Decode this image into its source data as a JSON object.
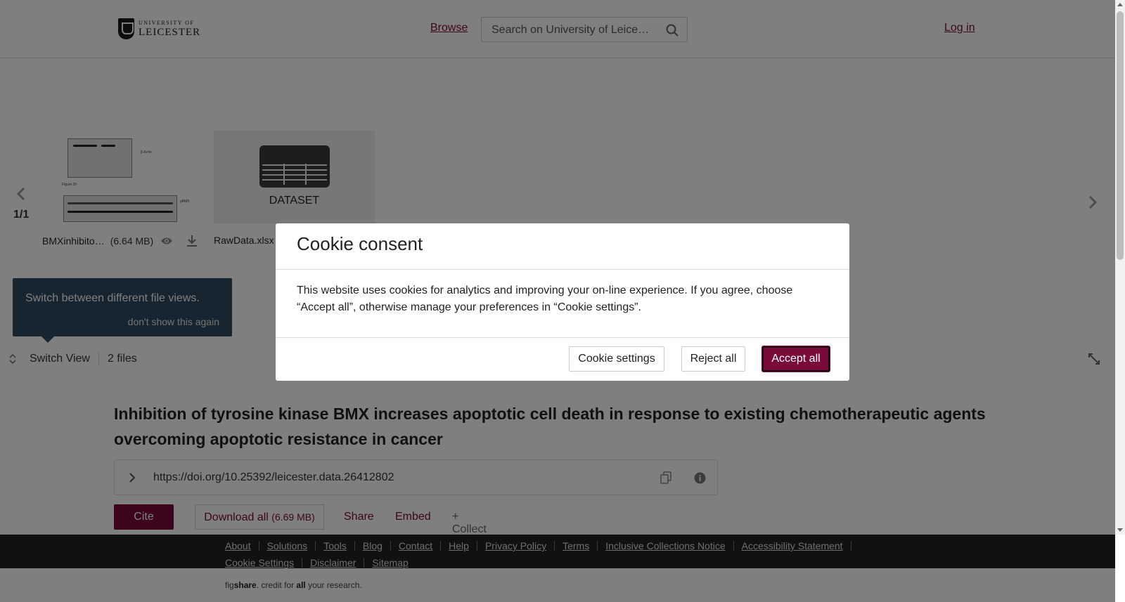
{
  "header": {
    "logo_small": "UNIVERSITY OF",
    "logo_big": "LEICESTER",
    "browse_label": "Browse",
    "search_placeholder": "Search on University of Leicester",
    "login_label": "Log in"
  },
  "carousel": {
    "counter": "1/1",
    "files": [
      {
        "name": "BMXinhibito…",
        "size": "(6.64 MB)"
      },
      {
        "name": "RawData.xlsx",
        "type_label": "DATASET"
      }
    ]
  },
  "tooltip": {
    "text": "Switch between different file views.",
    "dismiss": "don't show this again"
  },
  "switch_bar": {
    "switch_view_label": "Switch View",
    "files_count": "2 files"
  },
  "article": {
    "title": "Inhibition of tyrosine kinase BMX increases apoptotic cell death in response to existing chemotherapeutic agents overcoming apoptotic resistance in cancer",
    "doi_url": "https://doi.org/10.25392/leicester.data.26412802"
  },
  "actions": {
    "cite": "Cite",
    "download_all": "Download all",
    "download_size": "(6.69 MB)",
    "share": "Share",
    "embed": "Embed",
    "collect": "+ Collect"
  },
  "footer": {
    "links": [
      "About",
      "Solutions",
      "Tools",
      "Blog",
      "Contact",
      "Help",
      "Privacy Policy",
      "Terms",
      "Inclusive Collections Notice",
      "Accessibility Statement"
    ],
    "links_row2": [
      "Cookie Settings",
      "Disclaimer",
      "Sitemap"
    ],
    "credit_fig": "fig",
    "credit_share": "share",
    "credit_mid": ". credit for ",
    "credit_all": "all",
    "credit_end": " your research."
  },
  "cookie_modal": {
    "title": "Cookie consent",
    "body": "This website uses cookies for analytics and improving your on-line experience. If you agree, choose “Accept all”, otherwise manage your preferences in “Cookie settings”.",
    "settings_button": "Cookie settings",
    "reject_button": "Reject all",
    "accept_button": "Accept all"
  },
  "colors": {
    "brand": "#7a0a3a",
    "tooltip_bg": "#2e4a63",
    "footer_bg": "#222222"
  },
  "icons": [
    "search-icon",
    "chevron-left-icon",
    "chevron-right-icon",
    "eye-icon",
    "download-icon",
    "spreadsheet-icon",
    "switch-view-icon",
    "expand-icon",
    "chevron-right-icon",
    "copy-icon",
    "info-icon"
  ]
}
